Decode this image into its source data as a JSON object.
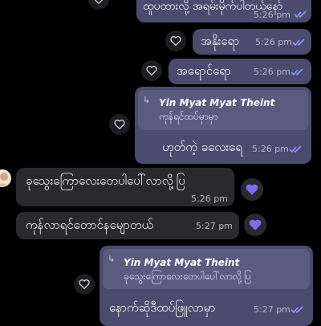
{
  "messages": [
    {
      "text": "ထူပထားလို့ အရမ်းမိုက်ပါတယ်နော်",
      "time": "5:26 pm"
    },
    {
      "text": "အနိုးရော",
      "time": "5:26 pm"
    },
    {
      "text": "အရောင်ရော",
      "time": "5:26 pm"
    },
    {
      "reply_name": "Yin Myat Myat Theint",
      "reply_text": "ကုန်ရင်ထပ်မှာမှာ",
      "text": "ဟုတ်ကဲ့ ခလေးရေ",
      "time": "5:26 pm"
    },
    {
      "text": "ခုသွေးကြောလေးတေပါပေါ်လာလို့ပြ",
      "time": "5:26 pm"
    },
    {
      "text": "ကုန်လာရင်တောင်နမျောတယ်",
      "time": "5:27 pm"
    },
    {
      "reply_name": "Yin Myat Myat Theint",
      "reply_text": "ခုသွေးကြောလေးတေပါပေါ်လာလို့ပြ",
      "text": "နောက်ဆိုဒီထပ်ဖြူလာမှာ",
      "time": "5:27 pm"
    }
  ],
  "colors": {
    "outgoing": "#4b4b6e",
    "incoming": "#2a2a2e",
    "accent": "#7b6cf0",
    "ticks": "#8a9cff"
  },
  "icons": {
    "react": "heart-outline-icon",
    "reaction": "purple-heart-icon",
    "read": "double-check-icon"
  }
}
